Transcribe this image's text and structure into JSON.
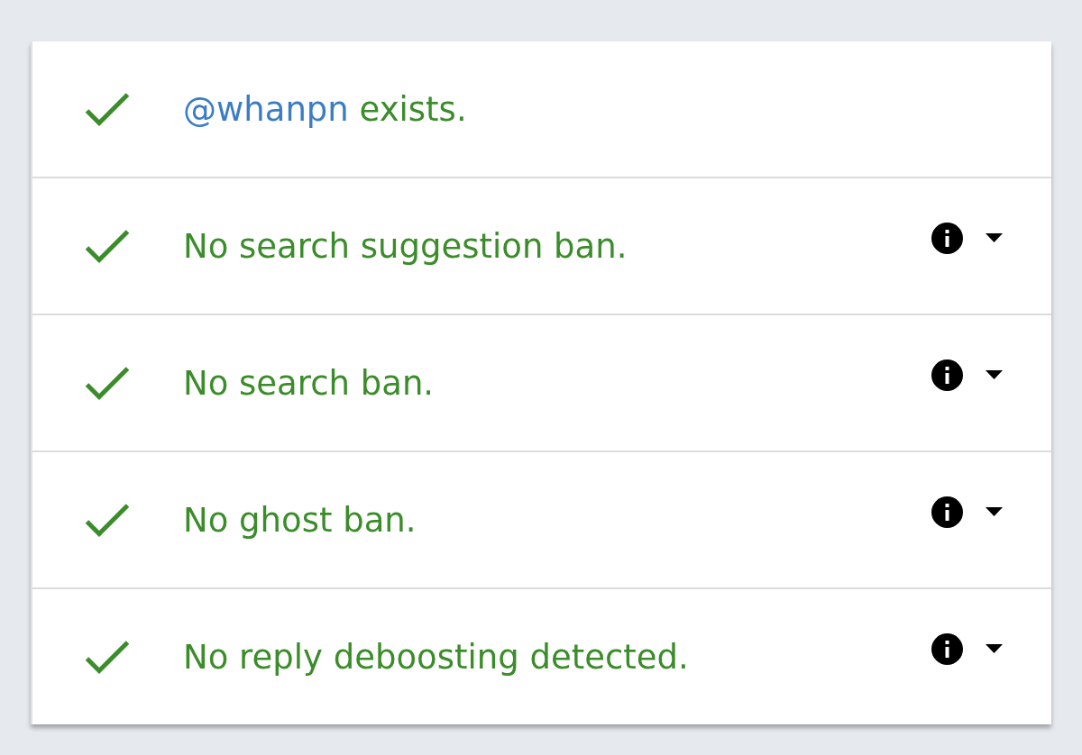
{
  "rows": [
    {
      "kind": "summary",
      "passed": true,
      "handle": "@whanpn",
      "text": "exists."
    },
    {
      "kind": "test",
      "passed": true,
      "text": "No search suggestion ban.",
      "expanded": false
    },
    {
      "kind": "test",
      "passed": true,
      "text": "No search ban.",
      "expanded": false
    },
    {
      "kind": "test",
      "passed": true,
      "text": "No ghost ban.",
      "expanded": false
    },
    {
      "kind": "test",
      "passed": true,
      "text": "No reply deboosting detected.",
      "expanded": false
    }
  ]
}
